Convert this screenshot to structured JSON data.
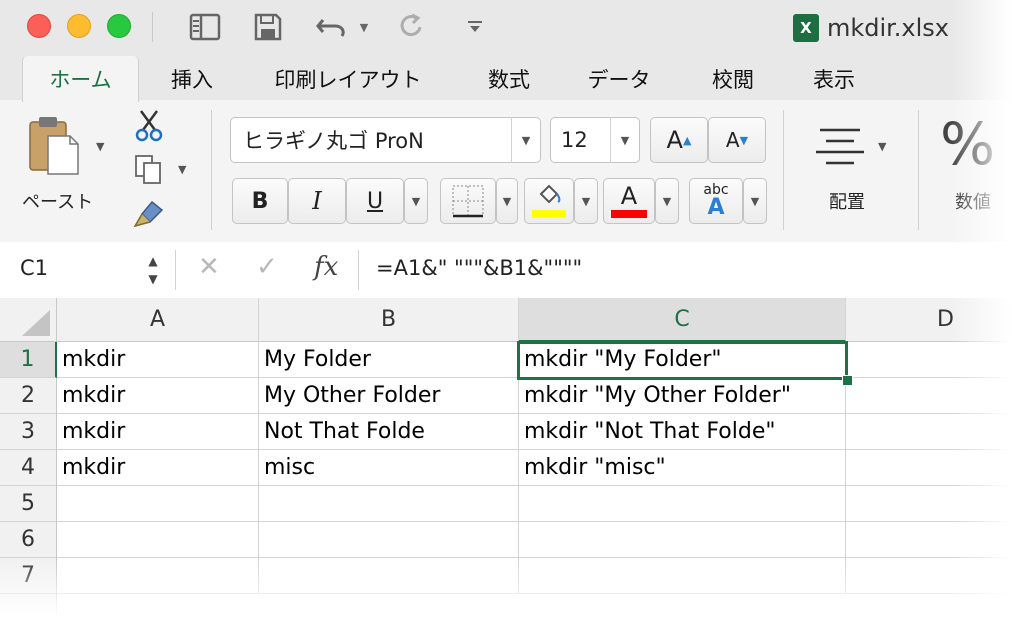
{
  "window": {
    "filename": "mkdir.xlsx",
    "file_icon_letter": "X"
  },
  "tabs": [
    "ホーム",
    "挿入",
    "印刷レイアウト",
    "数式",
    "データ",
    "校閲",
    "表示"
  ],
  "ribbon": {
    "paste_label": "ペースト",
    "font_name": "ヒラギノ丸ゴ ProN",
    "font_size": "12",
    "grow_font": "A",
    "shrink_font": "A",
    "bold": "B",
    "italic": "I",
    "underline": "U",
    "font_color_letter": "A",
    "phonetic_small": "abc",
    "phonetic_big": "A",
    "align_label": "配置",
    "number_symbol": "%",
    "number_label": "数値",
    "fill_color": "#ffff00",
    "font_color": "#ff0000"
  },
  "formula_bar": {
    "name_box": "C1",
    "fx": "fx",
    "formula": "=A1&\" \"\"\"&B1&\"\"\"\""
  },
  "columns": [
    "A",
    "B",
    "C",
    "D"
  ],
  "selected_column": "C",
  "rows": [
    {
      "num": "1",
      "a": "mkdir",
      "b": "My Folder",
      "c": "mkdir \"My Folder\""
    },
    {
      "num": "2",
      "a": "mkdir",
      "b": "My Other Folder",
      "c": "mkdir \"My Other Folder\""
    },
    {
      "num": "3",
      "a": "mkdir",
      "b": "Not That Folde",
      "c": "mkdir \"Not That Folde\""
    },
    {
      "num": "4",
      "a": "mkdir",
      "b": "misc",
      "c": "mkdir \"misc\""
    },
    {
      "num": "5",
      "a": "",
      "b": "",
      "c": ""
    },
    {
      "num": "6",
      "a": "",
      "b": "",
      "c": ""
    },
    {
      "num": "7",
      "a": "",
      "b": "",
      "c": ""
    }
  ],
  "accent_color": "#1e7145"
}
